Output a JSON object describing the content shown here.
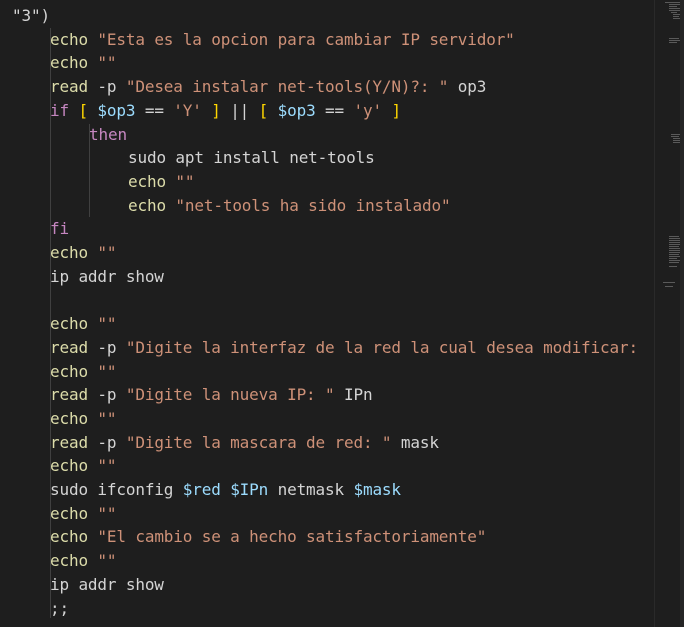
{
  "editor": {
    "colors": {
      "background": "#1e1e1e",
      "keyword": "#c586c0",
      "command": "#dcdcaa",
      "string": "#ce9178",
      "variable": "#9cdcfe",
      "control": "#569cd6",
      "bracket": "#ffd700",
      "text": "#d4d4d4"
    },
    "lines": [
      {
        "tokens": [
          {
            "t": "\"3\")",
            "c": "text"
          }
        ]
      },
      {
        "tokens": [
          {
            "t": "echo",
            "c": "command"
          },
          {
            "t": " ",
            "c": "text"
          },
          {
            "t": "\"Esta es la opcion para cambiar IP servidor\"",
            "c": "string"
          }
        ]
      },
      {
        "tokens": [
          {
            "t": "echo",
            "c": "command"
          },
          {
            "t": " ",
            "c": "text"
          },
          {
            "t": "\"\"",
            "c": "string"
          }
        ]
      },
      {
        "tokens": [
          {
            "t": "read",
            "c": "command"
          },
          {
            "t": " -p ",
            "c": "text"
          },
          {
            "t": "\"Desea instalar net-tools(Y/N)?: \"",
            "c": "string"
          },
          {
            "t": " op3",
            "c": "text"
          }
        ]
      },
      {
        "tokens": [
          {
            "t": "if",
            "c": "keyword"
          },
          {
            "t": " ",
            "c": "text"
          },
          {
            "t": "[",
            "c": "bracket"
          },
          {
            "t": " ",
            "c": "text"
          },
          {
            "t": "$op3",
            "c": "variable"
          },
          {
            "t": " == ",
            "c": "text"
          },
          {
            "t": "'Y'",
            "c": "string"
          },
          {
            "t": " ",
            "c": "text"
          },
          {
            "t": "]",
            "c": "bracket"
          },
          {
            "t": " || ",
            "c": "text"
          },
          {
            "t": "[",
            "c": "bracket"
          },
          {
            "t": " ",
            "c": "text"
          },
          {
            "t": "$op3",
            "c": "variable"
          },
          {
            "t": " == ",
            "c": "text"
          },
          {
            "t": "'y'",
            "c": "string"
          },
          {
            "t": " ",
            "c": "text"
          },
          {
            "t": "]",
            "c": "bracket"
          }
        ]
      },
      {
        "tokens": [
          {
            "t": "then",
            "c": "keyword"
          }
        ]
      },
      {
        "tokens": [
          {
            "t": "sudo apt install net-tools",
            "c": "text"
          }
        ]
      },
      {
        "tokens": [
          {
            "t": "echo",
            "c": "command"
          },
          {
            "t": " ",
            "c": "text"
          },
          {
            "t": "\"\"",
            "c": "string"
          }
        ]
      },
      {
        "tokens": [
          {
            "t": "echo",
            "c": "command"
          },
          {
            "t": " ",
            "c": "text"
          },
          {
            "t": "\"net-tools ha sido instalado\"",
            "c": "string"
          }
        ]
      },
      {
        "tokens": [
          {
            "t": "fi",
            "c": "keyword"
          }
        ]
      },
      {
        "tokens": [
          {
            "t": "echo",
            "c": "command"
          },
          {
            "t": " ",
            "c": "text"
          },
          {
            "t": "\"\"",
            "c": "string"
          }
        ]
      },
      {
        "tokens": [
          {
            "t": "ip addr show",
            "c": "text"
          }
        ]
      },
      {
        "tokens": []
      },
      {
        "tokens": [
          {
            "t": "echo",
            "c": "command"
          },
          {
            "t": " ",
            "c": "text"
          },
          {
            "t": "\"\"",
            "c": "string"
          }
        ]
      },
      {
        "tokens": [
          {
            "t": "read",
            "c": "command"
          },
          {
            "t": " -p ",
            "c": "text"
          },
          {
            "t": "\"Digite la interfaz de la red la cual desea modificar:",
            "c": "string"
          }
        ]
      },
      {
        "tokens": [
          {
            "t": "echo",
            "c": "command"
          },
          {
            "t": " ",
            "c": "text"
          },
          {
            "t": "\"\"",
            "c": "string"
          }
        ]
      },
      {
        "tokens": [
          {
            "t": "read",
            "c": "command"
          },
          {
            "t": " -p ",
            "c": "text"
          },
          {
            "t": "\"Digite la nueva IP: \"",
            "c": "string"
          },
          {
            "t": " IPn",
            "c": "text"
          }
        ]
      },
      {
        "tokens": [
          {
            "t": "echo",
            "c": "command"
          },
          {
            "t": " ",
            "c": "text"
          },
          {
            "t": "\"\"",
            "c": "string"
          }
        ]
      },
      {
        "tokens": [
          {
            "t": "read",
            "c": "command"
          },
          {
            "t": " -p ",
            "c": "text"
          },
          {
            "t": "\"Digite la mascara de red: \"",
            "c": "string"
          },
          {
            "t": " mask",
            "c": "text"
          }
        ]
      },
      {
        "tokens": [
          {
            "t": "echo",
            "c": "command"
          },
          {
            "t": " ",
            "c": "text"
          },
          {
            "t": "\"\"",
            "c": "string"
          }
        ]
      },
      {
        "tokens": [
          {
            "t": "sudo ifconfig ",
            "c": "text"
          },
          {
            "t": "$red",
            "c": "variable"
          },
          {
            "t": " ",
            "c": "text"
          },
          {
            "t": "$IPn",
            "c": "variable"
          },
          {
            "t": " netmask ",
            "c": "text"
          },
          {
            "t": "$mask",
            "c": "variable"
          }
        ]
      },
      {
        "tokens": [
          {
            "t": "echo",
            "c": "command"
          },
          {
            "t": " ",
            "c": "text"
          },
          {
            "t": "\"\"",
            "c": "string"
          }
        ]
      },
      {
        "tokens": [
          {
            "t": "echo",
            "c": "command"
          },
          {
            "t": " ",
            "c": "text"
          },
          {
            "t": "\"El cambio se a hecho satisfactoriamente\"",
            "c": "string"
          }
        ]
      },
      {
        "tokens": [
          {
            "t": "echo",
            "c": "command"
          },
          {
            "t": " ",
            "c": "text"
          },
          {
            "t": "\"\"",
            "c": "string"
          }
        ]
      },
      {
        "tokens": [
          {
            "t": "ip addr show",
            "c": "text"
          }
        ]
      },
      {
        "tokens": [
          {
            "t": ";;",
            "c": "text"
          }
        ]
      }
    ]
  }
}
